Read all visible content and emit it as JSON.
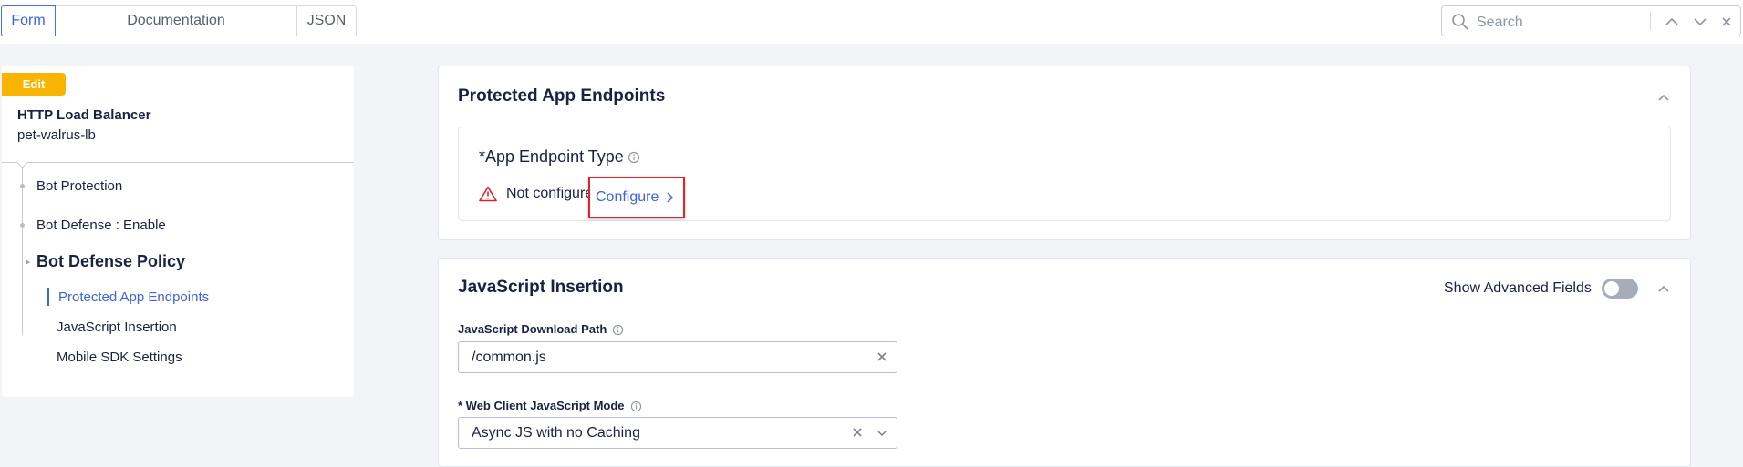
{
  "tabs": [
    {
      "label": "Form",
      "active": true
    },
    {
      "label": "Documentation",
      "active": false
    },
    {
      "label": "JSON",
      "active": false
    }
  ],
  "search": {
    "placeholder": "Search"
  },
  "sidebar": {
    "badge": "Edit",
    "object_type": "HTTP Load Balancer",
    "object_name": "pet-walrus-lb",
    "items": [
      {
        "label": "Bot Protection"
      },
      {
        "label": "Bot Defense : Enable"
      },
      {
        "label": "Bot Defense Policy"
      },
      {
        "label": "Protected App Endpoints",
        "active": true
      },
      {
        "label": "JavaScript Insertion"
      },
      {
        "label": "Mobile SDK Settings"
      }
    ]
  },
  "protected_endpoints": {
    "title": "Protected App Endpoints",
    "field_required_mark": "*",
    "field_label": "App Endpoint Type",
    "status": "Not configured",
    "configure_label": "Configure"
  },
  "js_insertion": {
    "title": "JavaScript Insertion",
    "advanced_label": "Show Advanced Fields",
    "advanced_enabled": false,
    "download_path_label": "JavaScript Download Path",
    "download_path_value": "/common.js",
    "mode_label": "* Web Client JavaScript Mode",
    "mode_value": "Async JS with no Caching"
  },
  "colors": {
    "accent": "#3d63dd",
    "badge": "#f8b400",
    "warning": "#e0232b"
  }
}
